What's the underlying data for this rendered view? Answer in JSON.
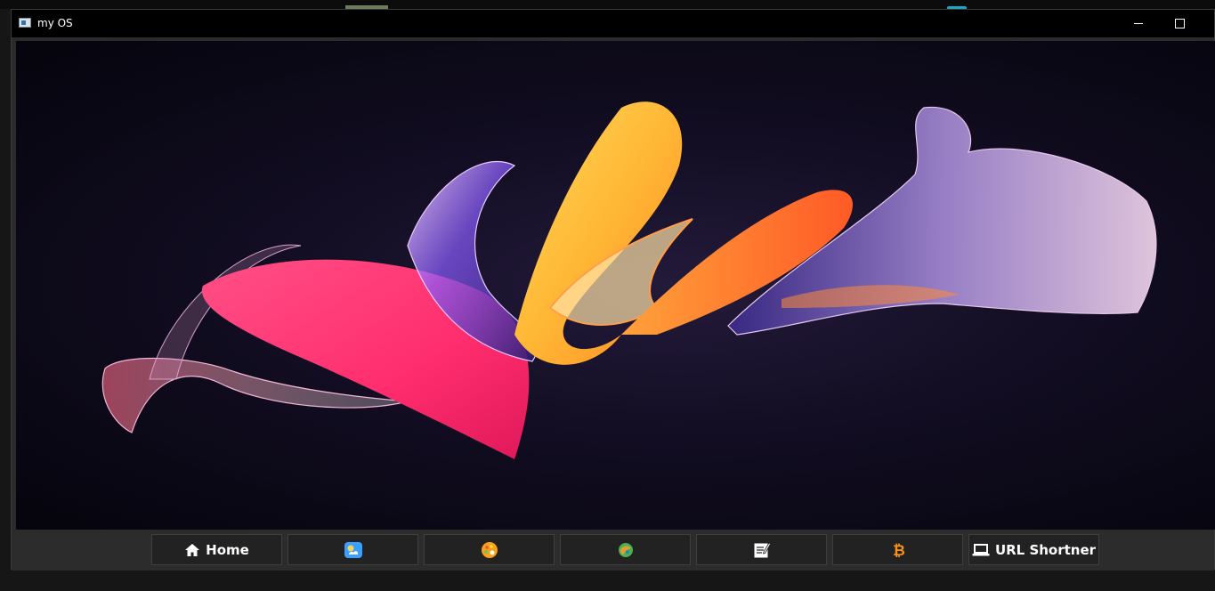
{
  "window": {
    "title": "my OS"
  },
  "wallpaper": {
    "description": "abstract 3D ribbon wallpaper on dark background",
    "colors": [
      "#ff3b7a",
      "#ffb23a",
      "#ff6a2a",
      "#6a4cff",
      "#f3c6ff"
    ]
  },
  "taskbar": {
    "buttons": [
      {
        "id": "home",
        "icon": "home-icon",
        "label": "Home"
      },
      {
        "id": "weather",
        "icon": "weather-icon",
        "label": ""
      },
      {
        "id": "paint",
        "icon": "palette-icon",
        "label": ""
      },
      {
        "id": "game",
        "icon": "game-icon",
        "label": ""
      },
      {
        "id": "notes",
        "icon": "notepad-icon",
        "label": ""
      },
      {
        "id": "crypto",
        "icon": "bitcoin-icon",
        "label": ""
      },
      {
        "id": "url",
        "icon": "laptop-icon",
        "label": "URL Shortner"
      }
    ]
  }
}
